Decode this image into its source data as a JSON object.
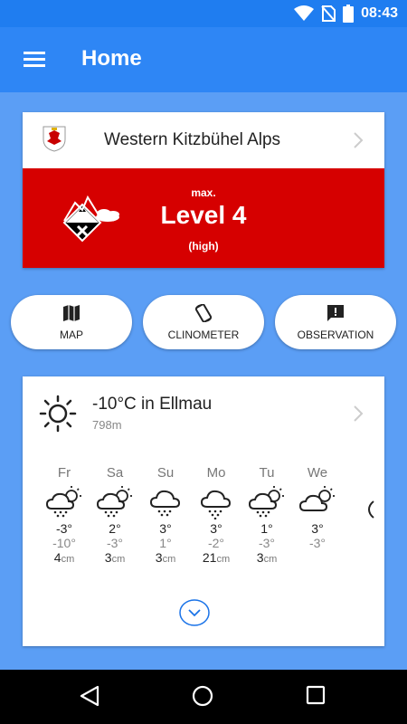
{
  "status_bar": {
    "time": "08:43",
    "icons": [
      "wifi-icon",
      "no-sim-icon",
      "battery-icon"
    ]
  },
  "app_bar": {
    "title": "Home",
    "menu_icon": "hamburger-menu-icon"
  },
  "region": {
    "name": "Western Kitzbühel Alps",
    "logo_icon": "tyrol-coat-of-arms-icon",
    "danger": {
      "prefix": "max.",
      "level": "Level 4",
      "description": "(high)",
      "icon": "danger-level-4-icon",
      "color": "#d60000"
    }
  },
  "actions": [
    {
      "label": "MAP",
      "icon": "map-icon"
    },
    {
      "label": "CLINOMETER",
      "icon": "clinometer-icon"
    },
    {
      "label": "OBSERVATION",
      "icon": "observation-icon"
    }
  ],
  "weather": {
    "current": "-10°C in Ellmau",
    "altitude": "798m",
    "icon": "sun-icon",
    "days": [
      {
        "day": "Fr",
        "hi": "-3°",
        "lo": "-10°",
        "snow": "4",
        "unit": "cm",
        "icon": "partly-cloudy-snow-icon"
      },
      {
        "day": "Sa",
        "hi": "2°",
        "lo": "-3°",
        "snow": "3",
        "unit": "cm",
        "icon": "partly-cloudy-snow-icon"
      },
      {
        "day": "Su",
        "hi": "3°",
        "lo": "1°",
        "snow": "3",
        "unit": "cm",
        "icon": "cloud-snow-icon"
      },
      {
        "day": "Mo",
        "hi": "3°",
        "lo": "-2°",
        "snow": "21",
        "unit": "cm",
        "icon": "cloud-snow-icon"
      },
      {
        "day": "Tu",
        "hi": "1°",
        "lo": "-3°",
        "snow": "3",
        "unit": "cm",
        "icon": "partly-cloudy-snow-icon"
      },
      {
        "day": "We",
        "hi": "3°",
        "lo": "-3°",
        "snow": "",
        "unit": "",
        "icon": "partly-cloudy-icon"
      }
    ]
  },
  "colors": {
    "app_bar": "#2e86f5",
    "status_bar": "#1f7df0",
    "background": "#5b9ef5",
    "accent": "#1a73e8"
  }
}
